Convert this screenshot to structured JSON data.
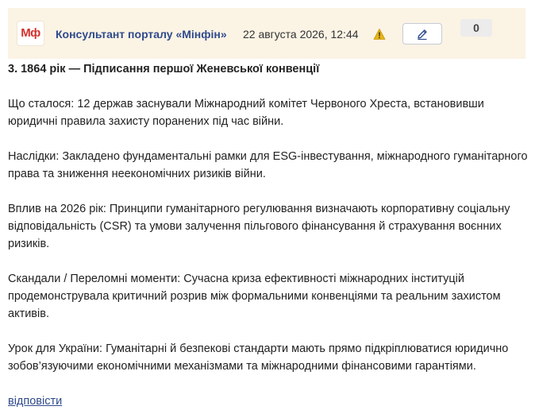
{
  "post": {
    "logo_text": "Мф",
    "author": "Консультант порталу «Мінфін»",
    "datetime": "22 августа 2026, 12:44",
    "warning_icon": "warning-icon",
    "edit_icon": "pencil-icon",
    "counter": "0"
  },
  "content": {
    "title": "3. 1864 рік — Підписання першої Женевської конвенції",
    "paragraphs": [
      "Що сталося: 12 держав заснували Міжнародний комітет Червоного Хреста, встановивши юридичні правила захисту поранених під час війни.",
      "Наслідки: Закладено фундаментальні рамки для ESG-інвестування, міжнародного гуманітарного права та зниження неекономічних ризиків війни.",
      "Вплив на 2026 рік: Принципи гуманітарного регулювання визначають корпоративну соціальну відповідальність (CSR) та умови залучення пільгового фінансування й страхування воєнних ризиків.",
      "Скандали / Переломні моменти: Сучасна криза ефективності міжнародних інституцій продемонструвала критичний розрив між формальними конвенціями та реальним захистом активів.",
      "Урок для України: Гуманітарні й безпекові стандарти мають прямо підкріплюватися юридично зобов’язуючими економічними механізмами та міжнародними фінансовими гарантіями."
    ],
    "reply_label": "відповісти"
  },
  "colors": {
    "header_bg": "#fbf3e4",
    "logo_red": "#d2312d",
    "link_blue": "#2f4a8c",
    "warning_yellow": "#e7b416"
  }
}
